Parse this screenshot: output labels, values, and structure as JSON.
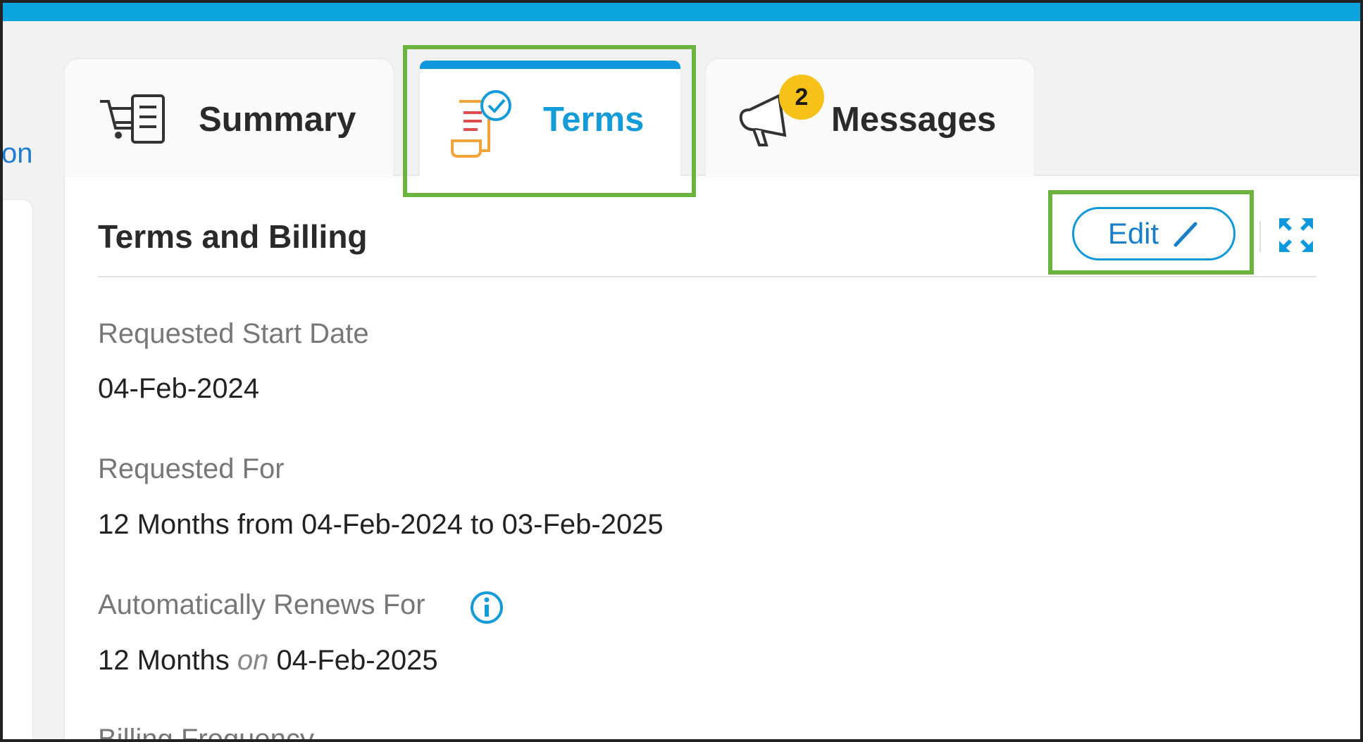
{
  "left_partial_text": "on",
  "tabs": [
    {
      "label": "Summary",
      "icon": "cart-list-icon",
      "active": false
    },
    {
      "label": "Terms",
      "icon": "terms-document-icon",
      "active": true
    },
    {
      "label": "Messages",
      "icon": "megaphone-icon",
      "active": false,
      "badge": "2"
    }
  ],
  "panel": {
    "title": "Terms and Billing",
    "edit_label": "Edit",
    "fields": {
      "start_label": "Requested Start Date",
      "start_value": "04-Feb-2024",
      "for_label": "Requested For",
      "for_value": "12 Months from 04-Feb-2024 to 03-Feb-2025",
      "renew_label": "Automatically Renews For",
      "renew_value_prefix": "12 Months",
      "renew_value_connector": "on",
      "renew_value_date": "04-Feb-2025",
      "billing_label": "Billing Frequency"
    }
  },
  "colors": {
    "accent": "#0aa4df",
    "highlight": "#6db33f",
    "badge": "#f6c21a"
  }
}
